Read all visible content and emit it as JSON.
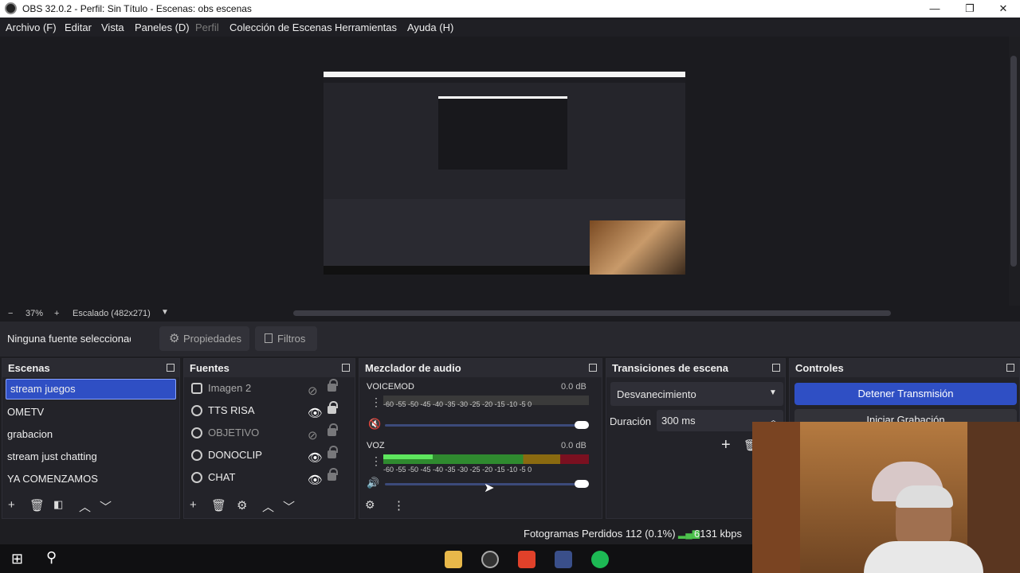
{
  "window": {
    "title": "OBS 32.0.2 - Perfil: Sin Título - Escenas: obs escenas",
    "minimize": "—",
    "maximize": "❐",
    "close": "✕"
  },
  "menu": [
    "Archivo (F)",
    "Editar",
    "Vista",
    "Paneles (D)",
    "Perfil",
    "Colección de Escenas",
    "Herramientas",
    "Ayuda (H)"
  ],
  "preview": {
    "zoom": "37%",
    "minus": "−",
    "plus": "+",
    "scale_mode": "Escalado (482x271)"
  },
  "toolbar": {
    "no_source": "Ninguna fuente seleccionad",
    "properties": "Propiedades",
    "filters": "Filtros"
  },
  "scenes": {
    "title": "Escenas",
    "items": [
      "stream juegos",
      "OMETV",
      "grabacion",
      "stream just chatting",
      "YA COMENZAMOS"
    ]
  },
  "sources": {
    "title": "Fuentes",
    "items": [
      {
        "name": "Imagen 2",
        "visible": false,
        "locked": false
      },
      {
        "name": "TTS RISA",
        "visible": true,
        "locked": true
      },
      {
        "name": "OBJETIVO",
        "visible": false,
        "locked": false
      },
      {
        "name": "DONOCLIP",
        "visible": true,
        "locked": false
      },
      {
        "name": "CHAT",
        "visible": true,
        "locked": false
      }
    ]
  },
  "mixer": {
    "title": "Mezclador de audio",
    "ticks": "-60  -55  -50  -45  -40  -35  -30  -25  -20  -15  -10  -5   0",
    "channels": [
      {
        "name": "VOICEMOD",
        "db": "0.0 dB",
        "level": 0.0,
        "volume": 1.0,
        "muted": true
      },
      {
        "name": "VOZ",
        "db": "0.0 dB",
        "level": 0.24,
        "volume": 1.0,
        "muted": false
      }
    ]
  },
  "transitions": {
    "title": "Transiciones de escena",
    "selected": "Desvanecimiento",
    "duration_label": "Duración",
    "duration_value": "300 ms"
  },
  "controls": {
    "title": "Controles",
    "stop_stream": "Detener Transmisión",
    "start_recording": "Iniciar Grabación"
  },
  "status": {
    "dropped_frames": "Fotogramas Perdidos 112 (0.1%)",
    "bitrate": "6131 kbps"
  },
  "colors": {
    "accent": "#2f4fc4",
    "background": "#1e1e22",
    "meter_green": "#4cc24c",
    "meter_yellow": "#8a7a10",
    "meter_red": "#8a1020"
  }
}
